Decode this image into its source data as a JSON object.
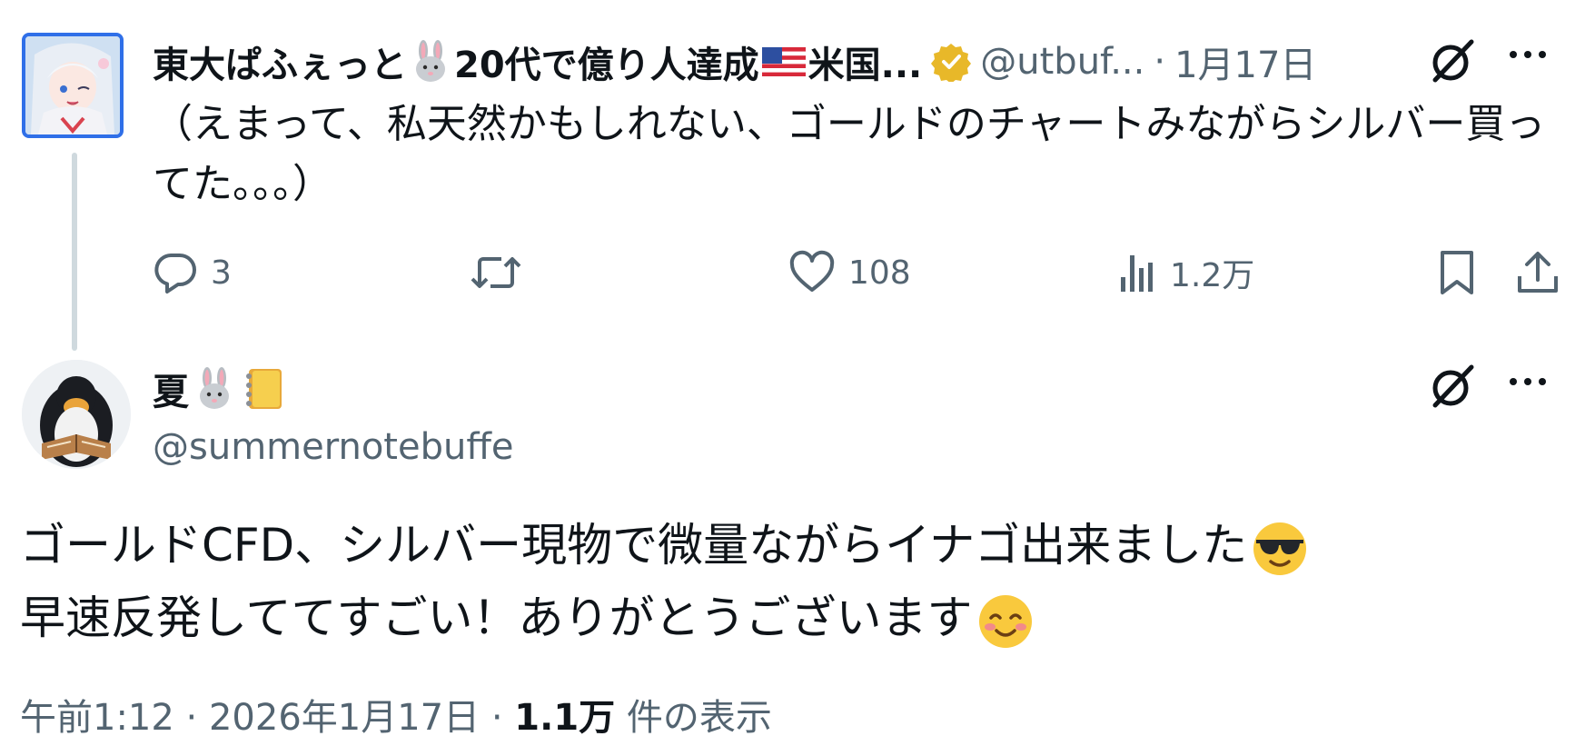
{
  "parent_tweet": {
    "author_name": "東大ぱふぇっと",
    "author_name_rest": "20代で億り人達成",
    "author_name_tail": "米国...",
    "handle": "@utbuf...",
    "separator": "·",
    "date": "1月17日",
    "text": "（えまって、私天然かもしれない、ゴールドのチャートみながらシルバー買ってた。。。）",
    "actions": {
      "replies": "3",
      "reposts": "",
      "likes": "108",
      "views": "1.2万"
    },
    "icons": [
      "rabbit-emoji",
      "us-flag-emoji",
      "verified-badge-icon",
      "grok-icon",
      "more-icon",
      "reply-icon",
      "repost-icon",
      "like-icon",
      "views-icon",
      "bookmark-icon",
      "share-icon"
    ],
    "colors": {
      "verified": "#e8b829",
      "secondary_text": "#536471",
      "thread_line": "#cfd9de",
      "avatar_border": "#2f6fe8"
    }
  },
  "reply_tweet": {
    "author_name": "夏",
    "handle": "@summernotebuffe",
    "body_line1": "ゴールドCFD、シルバー現物で微量ながらイナゴ出来ました",
    "body_line2": "早速反発しててすごい！ありがとうございます",
    "icons": [
      "rabbit-emoji",
      "notebook-emoji",
      "sunglasses-emoji",
      "smiling-emoji",
      "grok-icon",
      "more-icon"
    ],
    "meta": {
      "time": "午前1:12",
      "sep1": "·",
      "date": "2026年1月17日",
      "sep2": "·",
      "views_count": "1.1万",
      "views_label": "件の表示"
    }
  }
}
